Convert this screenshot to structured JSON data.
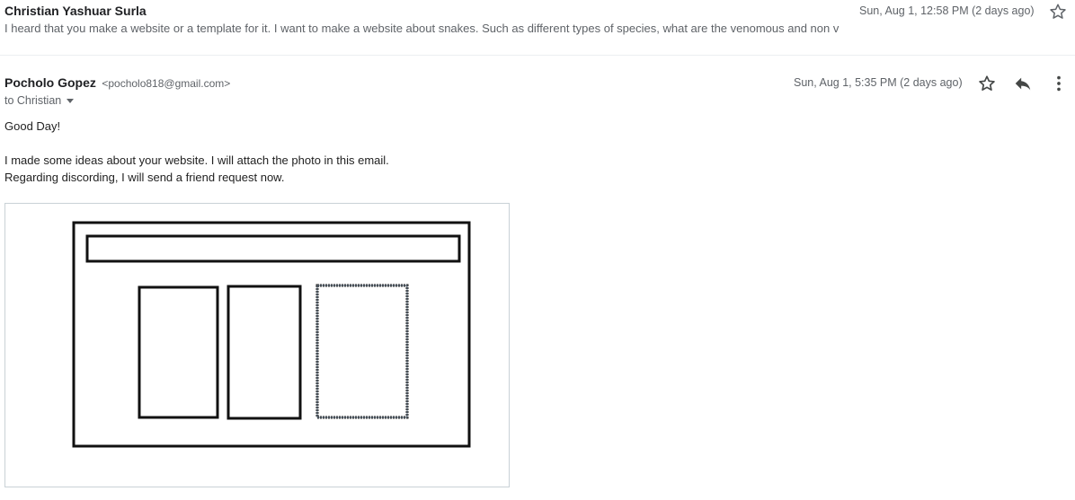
{
  "thread": {
    "first_message": {
      "sender_name": "Christian Yashuar Surla",
      "snippet": "I heard that you make a website or a template for it. I want to make a website about snakes. Such as different types of species, what are the venomous and non v",
      "date": "Sun, Aug 1, 12:58 PM (2 days ago)",
      "star_icon": "star-outline-icon"
    },
    "second_message": {
      "sender_name": "Pocholo Gopez",
      "sender_email": "<pocholo818@gmail.com>",
      "to_line": "to Christian",
      "date": "Sun, Aug 1, 5:35 PM (2 days ago)",
      "icons": [
        "star-outline-icon",
        "reply-icon",
        "more-vert-icon"
      ],
      "body": {
        "greeting": "Good Day!",
        "line1": "I made some ideas about your website. I will attach the photo in this email.",
        "line2": "Regarding discording, I will send a friend request now."
      },
      "attachment_icon": "wireframe-sketch-image"
    }
  },
  "colors": {
    "text_primary": "#202124",
    "text_secondary": "#5f6368",
    "divider": "#eceff1",
    "sketch_stroke": "#111111"
  }
}
